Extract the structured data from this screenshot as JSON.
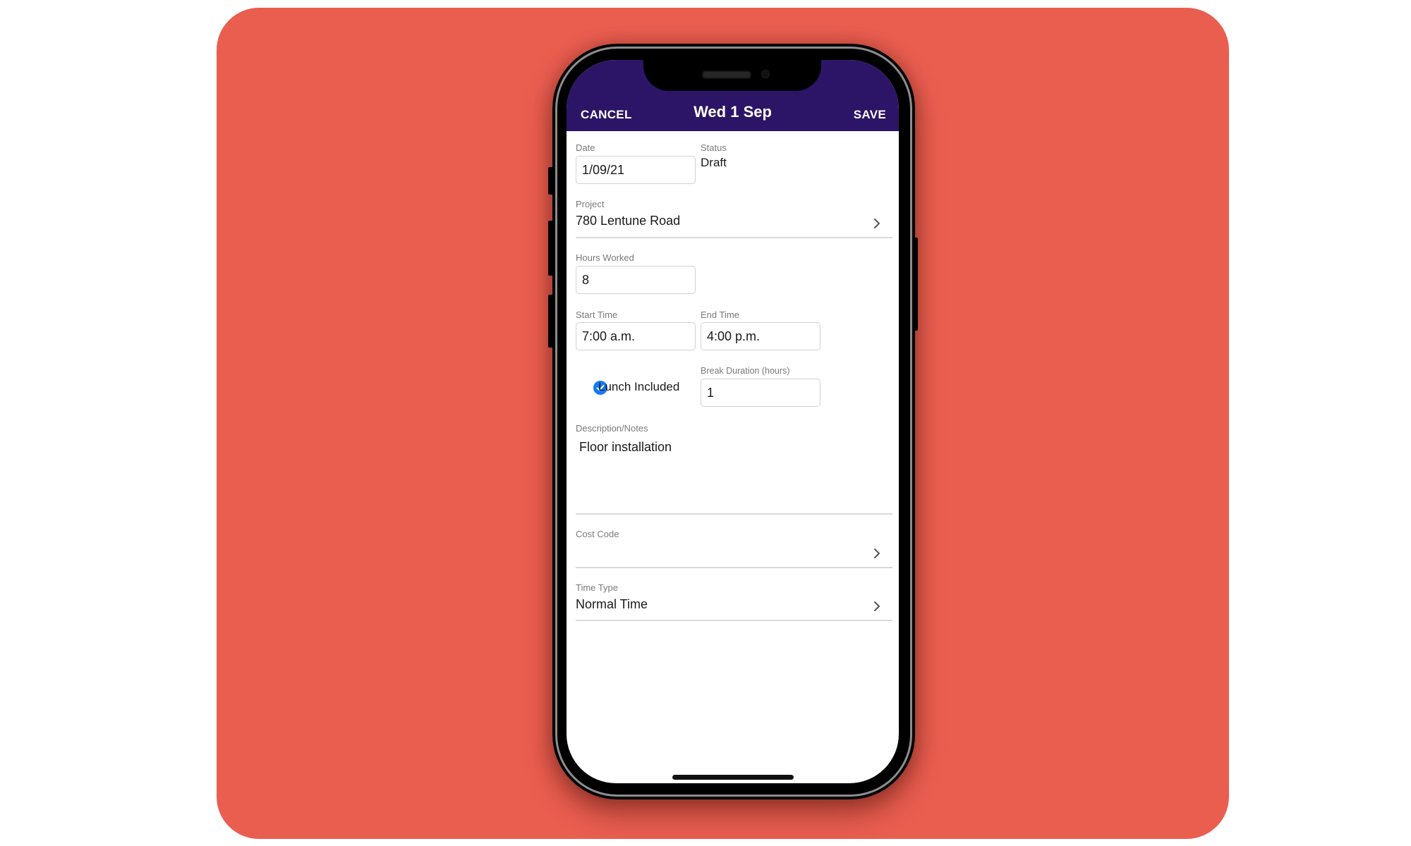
{
  "colors": {
    "background_card": "#EA5E50",
    "header": "#2C1566",
    "checkbox_accent": "#1479F2"
  },
  "header": {
    "cancel_label": "CANCEL",
    "title": "Wed 1 Sep",
    "save_label": "SAVE"
  },
  "form": {
    "date": {
      "label": "Date",
      "value": "1/09/21"
    },
    "status": {
      "label": "Status",
      "value": "Draft"
    },
    "project": {
      "label": "Project",
      "value": "780 Lentune Road",
      "icon": "chevron-right-icon"
    },
    "hours_worked": {
      "label": "Hours Worked",
      "value": "8"
    },
    "start_time": {
      "label": "Start Time",
      "value": "7:00 a.m."
    },
    "end_time": {
      "label": "End Time",
      "value": "4:00 p.m."
    },
    "lunch_included": {
      "label": "Lunch Included",
      "checked": true,
      "icon": "check-circle-icon"
    },
    "break_duration": {
      "label": "Break Duration (hours)",
      "value": "1"
    },
    "description": {
      "label": "Description/Notes",
      "value": "Floor installation"
    },
    "cost_code": {
      "label": "Cost Code",
      "value": "",
      "icon": "chevron-right-icon"
    },
    "time_type": {
      "label": "Time Type",
      "value": "Normal Time",
      "icon": "chevron-right-icon"
    }
  }
}
